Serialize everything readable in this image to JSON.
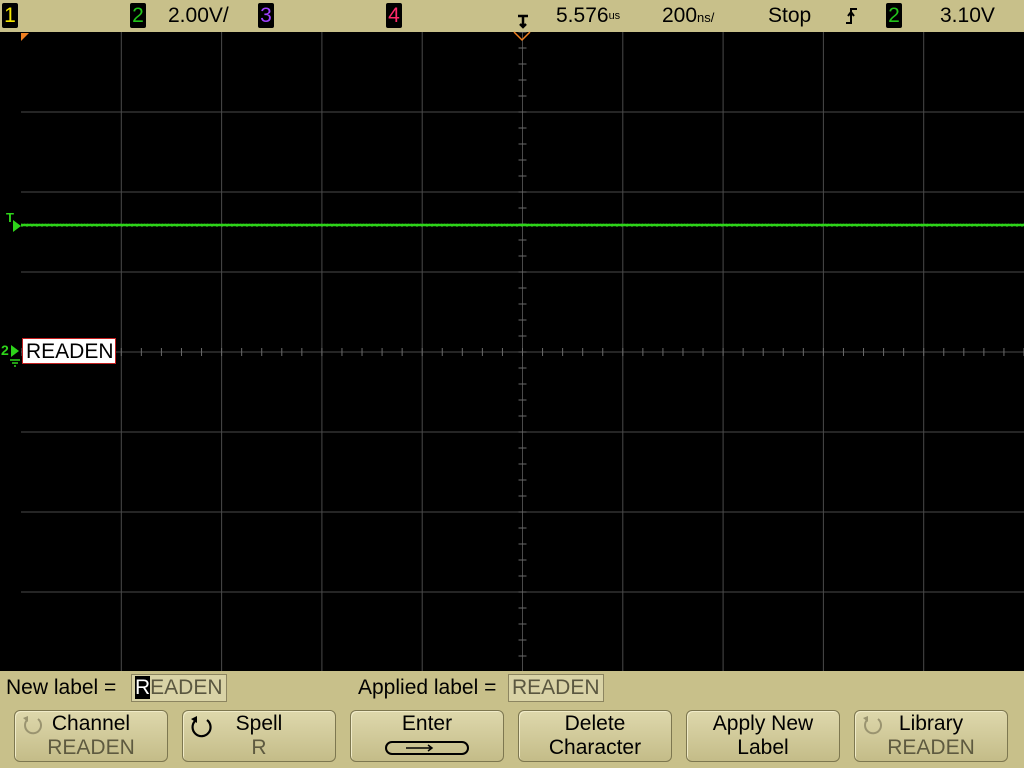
{
  "status_bar": {
    "ch1": "1",
    "ch2": "2",
    "ch2_scale": "2.00V/",
    "ch3": "3",
    "ch4": "4",
    "delay": "5.576",
    "delay_unit": "us",
    "timebase": "200",
    "timebase_unit": "ns/",
    "run_state": "Stop",
    "trigger_source": "2",
    "trigger_level": "3.10V"
  },
  "markers": {
    "trigger_level_marker": "T",
    "ch2_marker": "2"
  },
  "channel_label": "READEN",
  "bottom": {
    "new_label_caption": "New label =",
    "new_label_cursor": "R",
    "new_label_rest": "EADEN",
    "applied_label_caption": "Applied label =",
    "applied_label_value": "READEN"
  },
  "softkeys": [
    {
      "top": "Channel",
      "bottom": "READEN"
    },
    {
      "top": "Spell",
      "bottom": "R"
    },
    {
      "top": "Enter",
      "bottom": ""
    },
    {
      "top": "Delete",
      "bottom": "Character"
    },
    {
      "top": "Apply New",
      "bottom": "Label"
    },
    {
      "top": "Library",
      "bottom": "READEN"
    }
  ],
  "colors": {
    "ch1": "#f5e600",
    "ch2": "#22c31a",
    "ch3": "#a040ff",
    "ch4": "#ff2a6a",
    "panel": "#c8c08a",
    "grid": "#4a4a4a",
    "trace": "#2ed41a"
  }
}
